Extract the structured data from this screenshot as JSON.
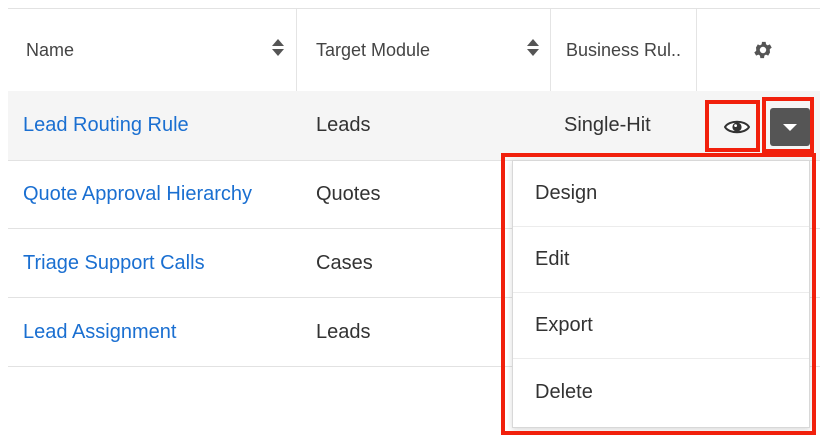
{
  "table": {
    "columns": [
      {
        "label": "Name"
      },
      {
        "label": "Target Module"
      },
      {
        "label": "Business Rul.."
      }
    ],
    "settings_icon": "gear-icon",
    "rows": [
      {
        "name": "Lead Routing Rule",
        "module": "Leads",
        "rule": "Single-Hit"
      },
      {
        "name": "Quote Approval Hierarchy",
        "module": "Quotes",
        "rule": ""
      },
      {
        "name": "Triage Support Calls",
        "module": "Cases",
        "rule": ""
      },
      {
        "name": "Lead Assignment",
        "module": "Leads",
        "rule": ""
      }
    ]
  },
  "actions": {
    "preview_icon": "eye-icon",
    "dropdown_icon": "caret-down-icon",
    "menu": [
      "Design",
      "Edit",
      "Export",
      "Delete"
    ]
  },
  "colors": {
    "link": "#1a6fd1",
    "highlight": "#f1200c",
    "dropdown_button": "#555555"
  }
}
